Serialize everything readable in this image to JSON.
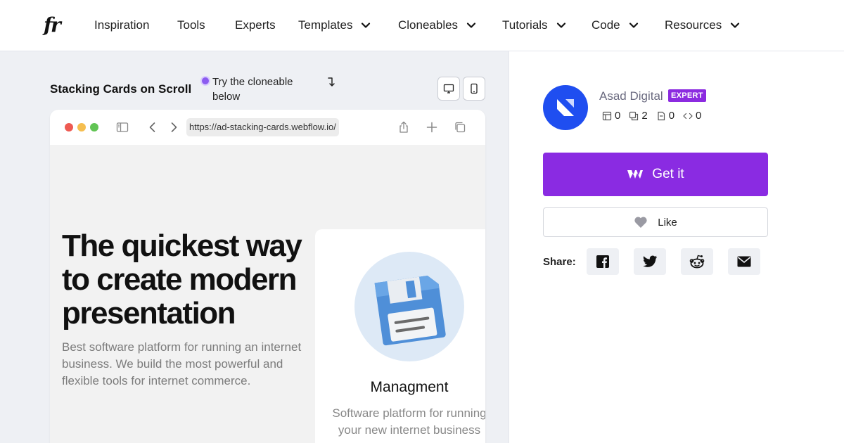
{
  "nav": {
    "logo": "fr",
    "items": [
      {
        "label": "Inspiration",
        "dropdown": false
      },
      {
        "label": "Tools",
        "dropdown": false
      },
      {
        "label": "Experts",
        "dropdown": false
      },
      {
        "label": "Templates",
        "dropdown": true
      },
      {
        "label": "Cloneables",
        "dropdown": true
      },
      {
        "label": "Tutorials",
        "dropdown": true
      },
      {
        "label": "Code",
        "dropdown": true
      },
      {
        "label": "Resources",
        "dropdown": true
      }
    ]
  },
  "preview": {
    "title": "Stacking Cards on Scroll",
    "hint": "Try the cloneable below",
    "browser": {
      "url": "https://ad-stacking-cards.webflow.io/"
    },
    "hero": {
      "heading": "The quickest way to create modern presentation",
      "paragraph": "Best software platform for running an internet business. We build the most powerful and flexible tools for internet commerce."
    },
    "card": {
      "title": "Managment",
      "text": "Software platform for running your new internet business"
    }
  },
  "author": {
    "name": "Asad Digital",
    "badge": "EXPERT",
    "stats": {
      "templates": "0",
      "cloneables": "2",
      "pages": "0",
      "code": "0"
    }
  },
  "actions": {
    "get_label": "Get it",
    "like_label": "Like",
    "share_label": "Share:"
  },
  "colors": {
    "accent": "#8a2be2",
    "avatar": "#1f4ef0",
    "badge": "#8c2be0"
  }
}
